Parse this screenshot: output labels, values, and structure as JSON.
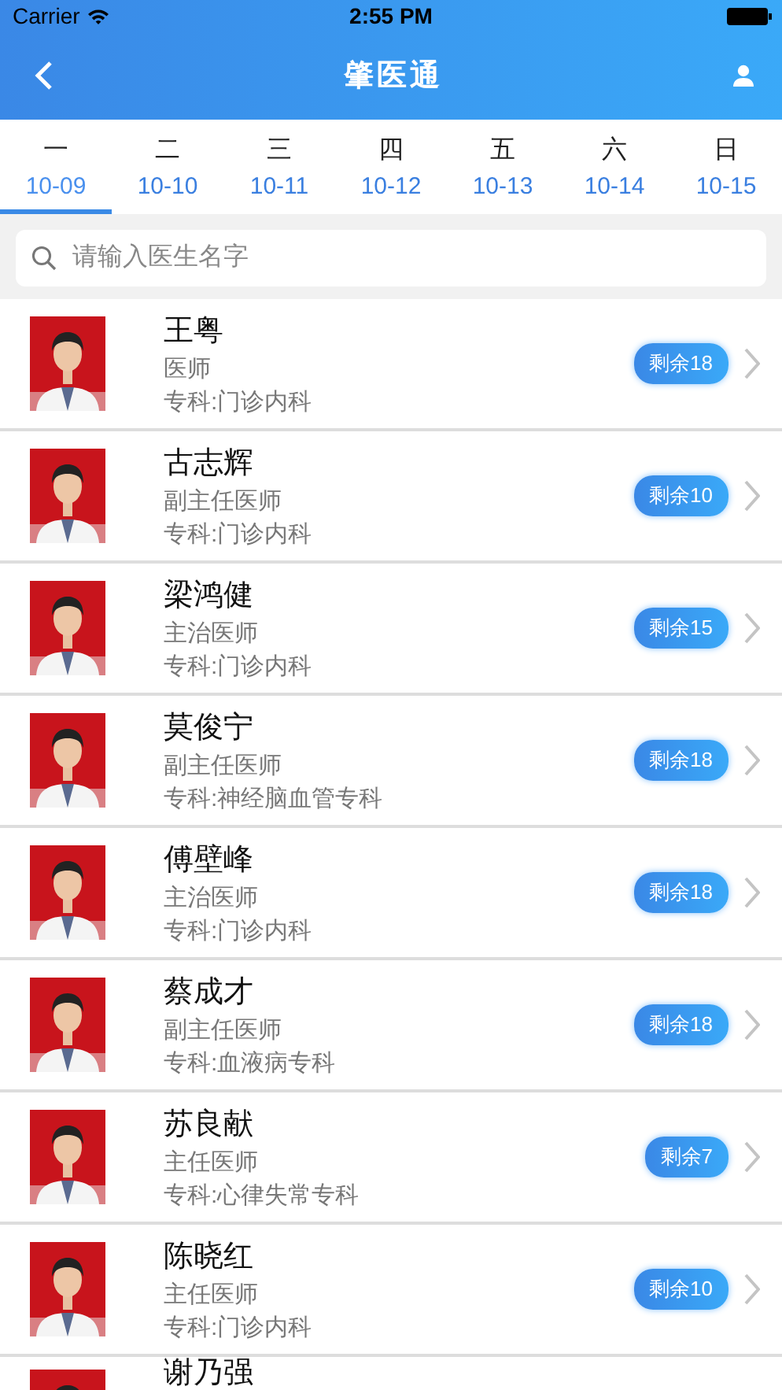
{
  "status_bar": {
    "carrier": "Carrier",
    "time": "2:55 PM"
  },
  "nav": {
    "title": "肇医通"
  },
  "day_tabs": [
    {
      "weekday": "一",
      "date": "10-09",
      "selected": true
    },
    {
      "weekday": "二",
      "date": "10-10",
      "selected": false
    },
    {
      "weekday": "三",
      "date": "10-11",
      "selected": false
    },
    {
      "weekday": "四",
      "date": "10-12",
      "selected": false
    },
    {
      "weekday": "五",
      "date": "10-13",
      "selected": false
    },
    {
      "weekday": "六",
      "date": "10-14",
      "selected": false
    },
    {
      "weekday": "日",
      "date": "10-15",
      "selected": false
    }
  ],
  "search": {
    "placeholder": "请输入医生名字"
  },
  "doctors": [
    {
      "name": "王粤",
      "title": "医师",
      "department": "专科:门诊内科",
      "remaining": "剩余18"
    },
    {
      "name": "古志辉",
      "title": "副主任医师",
      "department": "专科:门诊内科",
      "remaining": "剩余10"
    },
    {
      "name": "梁鸿健",
      "title": "主治医师",
      "department": "专科:门诊内科",
      "remaining": "剩余15"
    },
    {
      "name": "莫俊宁",
      "title": "副主任医师",
      "department": "专科:神经脑血管专科",
      "remaining": "剩余18"
    },
    {
      "name": "傅壁峰",
      "title": "主治医师",
      "department": "专科:门诊内科",
      "remaining": "剩余18"
    },
    {
      "name": "蔡成才",
      "title": "副主任医师",
      "department": "专科:血液病专科",
      "remaining": "剩余18"
    },
    {
      "name": "苏良献",
      "title": "主任医师",
      "department": "专科:心律失常专科",
      "remaining": "剩余7"
    },
    {
      "name": "陈晓红",
      "title": "主任医师",
      "department": "专科:门诊内科",
      "remaining": "剩余10"
    },
    {
      "name": "谢乃强"
    }
  ]
}
